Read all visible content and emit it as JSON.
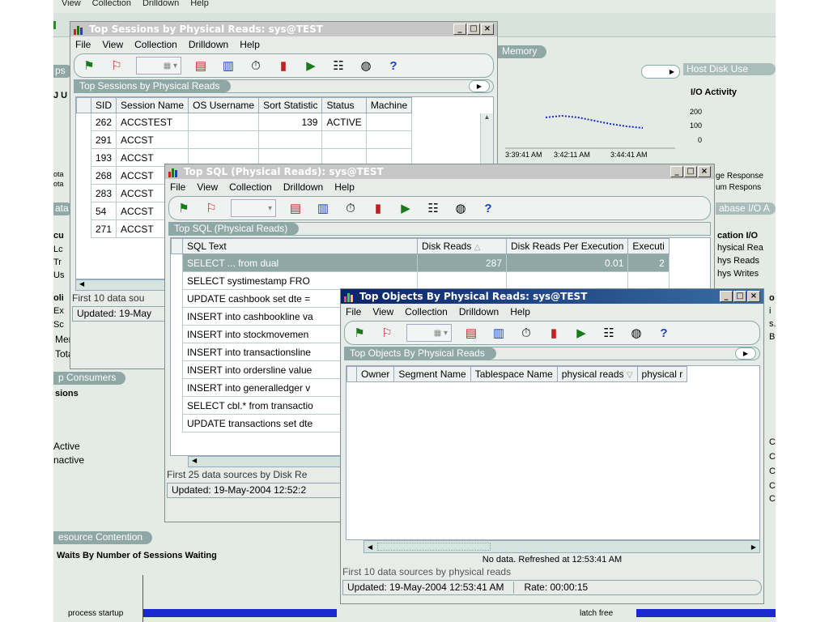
{
  "background": {
    "menubar": [
      "View",
      "Collection",
      "Drilldown",
      "Help"
    ],
    "memory_tab": "Memory",
    "host_disk_tab": "Host Disk Use",
    "io_activity": "I/O Activity",
    "io_ticks": [
      "200",
      "100",
      "0"
    ],
    "time_ticks": [
      "3:39:41 AM",
      "3:42:11 AM",
      "3:44:41 AM"
    ],
    "response_labels": [
      "ge Response",
      "um Respons"
    ],
    "database_io_tab": "abase I/O A",
    "app_io": "cation I/O",
    "app_io_items": [
      "hysical Rea",
      "hys Reads",
      "hys Writes"
    ],
    "left_snips": [
      "ps",
      "J U",
      "ota",
      "ota",
      "ata",
      "cu",
      "Lc",
      "Tr",
      "Us",
      "oli",
      "Ex",
      "Sc"
    ],
    "memory_sort": "Memory Sort %",
    "total_scans": "Total Table Scans/Se",
    "consumers_tab": "p Consumers",
    "sessions": "sions",
    "active": "Active",
    "inactive": "nactive",
    "resource_tab": "esource Contention",
    "waits": "Waits By Number of Sessions Waiting",
    "process_startup": "process startup",
    "latch_free": "latch free",
    "right_c": [
      "C",
      "C",
      "C",
      "C",
      "C"
    ],
    "right_snips": [
      "o",
      "i",
      "s.",
      "B"
    ]
  },
  "win_sessions": {
    "title": "Top Sessions by Physical Reads: sys@TEST",
    "menu": [
      "File",
      "View",
      "Collection",
      "Drilldown",
      "Help"
    ],
    "panel_title": "Top Sessions by Physical Reads",
    "columns": [
      "SID",
      "Session Name",
      "OS Username",
      "Sort Statistic",
      "Status",
      "Machine"
    ],
    "rows": [
      [
        "262",
        "ACCSTEST",
        "",
        "139",
        "ACTIVE",
        ""
      ],
      [
        "291",
        "ACCST",
        "",
        "",
        "",
        ""
      ],
      [
        "193",
        "ACCST",
        "",
        "",
        "",
        ""
      ],
      [
        "268",
        "ACCST",
        "",
        "",
        "",
        ""
      ],
      [
        "283",
        "ACCST",
        "",
        "",
        "",
        ""
      ],
      [
        "54",
        "ACCST",
        "",
        "",
        "",
        ""
      ],
      [
        "271",
        "ACCST",
        "",
        "",
        "",
        ""
      ]
    ],
    "footer": "First 10 data sou",
    "updated": "Updated: 19-May"
  },
  "win_sql": {
    "title": "Top SQL (Physical Reads): sys@TEST",
    "menu": [
      "File",
      "View",
      "Collection",
      "Drilldown",
      "Help"
    ],
    "panel_title": "Top SQL (Physical Reads)",
    "columns": [
      "SQL Text",
      "Disk Reads",
      "Disk Reads Per Execution",
      "Executi"
    ],
    "rows": [
      [
        "SELECT ... from dual",
        "287",
        "0.01",
        "2"
      ],
      [
        "SELECT systimestamp FRO",
        "",
        "",
        ""
      ],
      [
        "UPDATE cashbook set dte =",
        "",
        "",
        ""
      ],
      [
        "INSERT into cashbookline va",
        "",
        "",
        ""
      ],
      [
        "INSERT into stockmovemen",
        "",
        "",
        ""
      ],
      [
        "INSERT into transactionsline",
        "",
        "",
        ""
      ],
      [
        "INSERT into ordersline value",
        "",
        "",
        ""
      ],
      [
        "INSERT into generalledger v",
        "",
        "",
        ""
      ],
      [
        "SELECT cbl.* from transactio",
        "",
        "",
        ""
      ],
      [
        "UPDATE transactions set dte",
        "",
        "",
        ""
      ]
    ],
    "footer": "First 25 data sources by Disk Re",
    "updated": "Updated: 19-May-2004 12:52:2"
  },
  "win_objects": {
    "title": "Top Objects By Physical Reads: sys@TEST",
    "menu": [
      "File",
      "View",
      "Collection",
      "Drilldown",
      "Help"
    ],
    "panel_title": "Top Objects By Physical Reads",
    "columns": [
      "Owner",
      "Segment Name",
      "Tablespace Name",
      "physical reads",
      "physical r"
    ],
    "no_data": "No data. Refreshed at 12:53:41 AM",
    "footer": "First 10 data sources by physical reads",
    "updated": "Updated: 19-May-2004 12:53:41 AM",
    "rate": "Rate: 00:00:15"
  }
}
